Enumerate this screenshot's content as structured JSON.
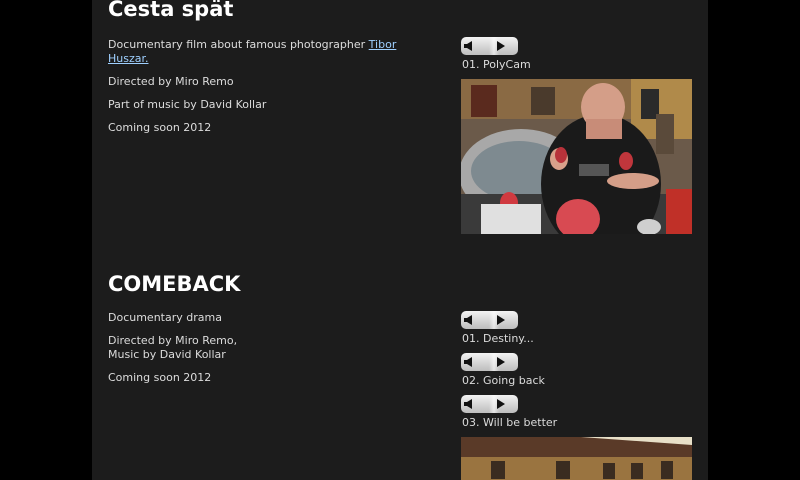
{
  "sections": [
    {
      "title": "Cesta spät",
      "description": {
        "line1_prefix": "Documentary film about famous photographer ",
        "line1_link": "Tibor Huszar.",
        "line2": "Directed by Miro Remo",
        "line3": "Part of music by David Kollar",
        "line4": "Coming soon 2012"
      },
      "tracks": [
        {
          "label": "01. PolyCam"
        }
      ]
    },
    {
      "title": "COMEBACK",
      "description": {
        "line1": "Documentary drama",
        "line2a": "Directed by Miro Remo,",
        "line2b": "Music by David Kollar",
        "line3": "Coming soon 2012"
      },
      "tracks": [
        {
          "label": "01. Destiny..."
        },
        {
          "label": "02. Going back"
        },
        {
          "label": "03. Will be better"
        }
      ]
    }
  ],
  "colors": {
    "window_background": "#000000",
    "page_background": "#1c1c1c",
    "text": "#dcdcdc",
    "heading": "#ffffff",
    "link": "#9fd0ff"
  },
  "icons": {
    "volume": "speaker-icon",
    "play": "play-icon"
  }
}
